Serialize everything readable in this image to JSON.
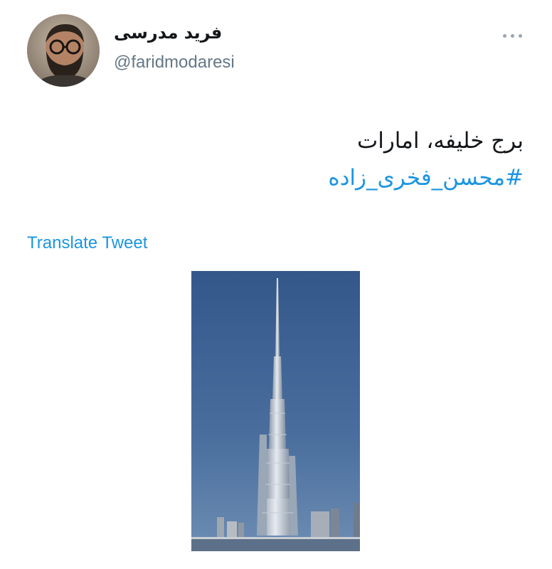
{
  "tweet": {
    "author": {
      "display_name": "فرید مدرسی",
      "handle": "@faridmodaresi"
    },
    "text_line": "برج خلیفه، امارات",
    "hashtag": "#محسن_فخری_زاده",
    "translate_label": "Translate Tweet",
    "more_icon": "more-horizontal-icon",
    "media": {
      "kind": "photo",
      "subject": "skyscraper-tower"
    }
  },
  "colors": {
    "link": "#1b95e0",
    "text": "#14171a",
    "secondary": "#657786",
    "sky": "#3d5f8c"
  }
}
